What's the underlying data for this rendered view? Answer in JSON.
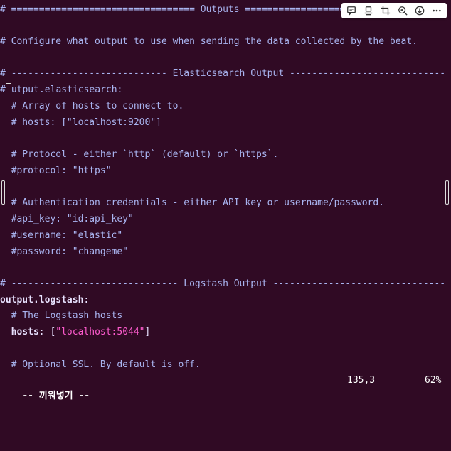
{
  "toolbar": {
    "buttons": [
      "comment-icon",
      "screenshot-icon",
      "crop-icon",
      "zoom-in-icon",
      "download-icon",
      "more-icon"
    ]
  },
  "lines": {
    "l0": "# ================================= Outputs ===================================",
    "l1": "",
    "l2": "# Configure what output to use when sending the data collected by the beat.",
    "l3": "",
    "l4": "# ---------------------------- Elasticsearch Output ----------------------------",
    "l5_pre": "#",
    "l5_cursor_char": "o",
    "l5_post": "utput.elasticsearch:",
    "l6": "  # Array of hosts to connect to.",
    "l7": "  # hosts: [\"localhost:9200\"]",
    "l8": "",
    "l9": "  # Protocol - either `http` (default) or `https`.",
    "l10": "  #protocol: \"https\"",
    "l11": "",
    "l12": "  # Authentication credentials - either API key or username/password.",
    "l13": "  #api_key: \"id:api_key\"",
    "l14": "  #username: \"elastic\"",
    "l15": "  #password: \"changeme\"",
    "l16": "",
    "l17": "# ------------------------------ Logstash Output -------------------------------",
    "l18_key": "output.logstash",
    "l18_colon": ":",
    "l19": "  # The Logstash hosts",
    "l20_indent": "  ",
    "l20_key": "hosts",
    "l20_sep": ": [",
    "l20_str": "\"localhost:5044\"",
    "l20_end": "]",
    "l21": "",
    "l22": "  # Optional SSL. By default is off."
  },
  "status": {
    "mode": "-- 끼워넣기 --",
    "position": "135,3",
    "percent": "62%"
  },
  "colors": {
    "background": "#300a24",
    "comment": "#a9b4f0",
    "string": "#ff5ccf",
    "text": "#dddddd"
  }
}
